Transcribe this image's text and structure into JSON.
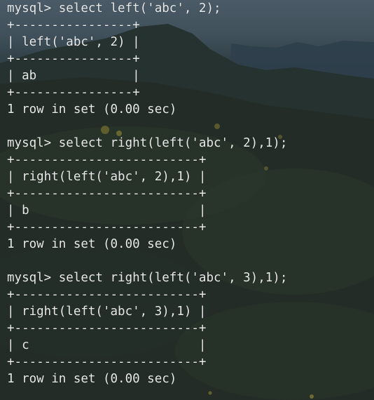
{
  "terminal": {
    "lines": [
      "mysql> select left('abc', 2);",
      "+----------------+",
      "| left('abc', 2) |",
      "+----------------+",
      "| ab             |",
      "+----------------+",
      "1 row in set (0.00 sec)",
      "",
      "mysql> select right(left('abc', 2),1);",
      "+-------------------------+",
      "| right(left('abc', 2),1) |",
      "+-------------------------+",
      "| b                       |",
      "+-------------------------+",
      "1 row in set (0.00 sec)",
      "",
      "mysql> select right(left('abc', 3),1);",
      "+-------------------------+",
      "| right(left('abc', 3),1) |",
      "+-------------------------+",
      "| c                       |",
      "+-------------------------+",
      "1 row in set (0.00 sec)"
    ]
  },
  "colors": {
    "text": "#e9eaea",
    "background": "#222b27"
  }
}
